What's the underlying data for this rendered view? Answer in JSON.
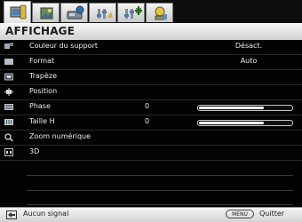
{
  "tabs": [
    {
      "icon": "display-settings-icon",
      "active": true
    },
    {
      "icon": "picture-settings-icon",
      "active": false
    },
    {
      "icon": "source-settings-icon",
      "active": false
    },
    {
      "icon": "system-setup-icon",
      "active": false
    },
    {
      "icon": "advanced-setup-icon",
      "active": false
    },
    {
      "icon": "information-icon",
      "active": false
    }
  ],
  "title": "AFFICHAGE",
  "menu": {
    "items": [
      {
        "icon": "wall-color-icon",
        "label": "Couleur du support",
        "value": "Désact."
      },
      {
        "icon": "aspect-ratio-icon",
        "label": "Format",
        "value": "Auto"
      },
      {
        "icon": "keystone-icon",
        "label": "Trapèze"
      },
      {
        "icon": "position-icon",
        "label": "Position"
      },
      {
        "icon": "phase-icon",
        "label": "Phase",
        "number": "0",
        "level": 0
      },
      {
        "icon": "h-size-icon",
        "label": "Taille H",
        "number": "0",
        "level": 0
      },
      {
        "icon": "digital-zoom-icon",
        "label": "Zoom numérique"
      },
      {
        "icon": "3d-icon",
        "label": "3D"
      }
    ]
  },
  "footer": {
    "icon": "input-source-icon",
    "status": "Aucun signal",
    "menu_key": "MENU",
    "action": "Quitter"
  },
  "colors": {
    "menu_background": "#030303",
    "text": "#ececec",
    "tab_bar": "#0d0d0d"
  }
}
